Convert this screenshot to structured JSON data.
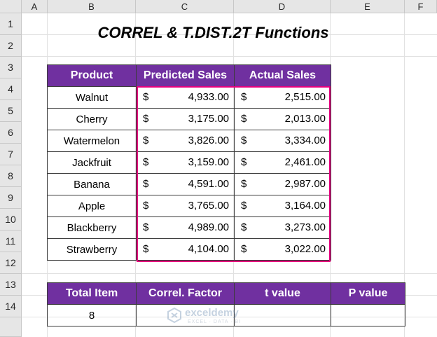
{
  "columns": [
    "A",
    "B",
    "C",
    "D",
    "E",
    "F"
  ],
  "rows": [
    "1",
    "2",
    "3",
    "4",
    "5",
    "6",
    "7",
    "8",
    "9",
    "10",
    "11",
    "12",
    "13",
    "14"
  ],
  "title": "CORREL & T.DIST.2T Functions",
  "main_table": {
    "headers": [
      "Product",
      "Predicted Sales",
      "Actual Sales"
    ],
    "currency": "$",
    "rows": [
      {
        "product": "Walnut",
        "predicted": "4,933.00",
        "actual": "2,515.00"
      },
      {
        "product": "Cherry",
        "predicted": "3,175.00",
        "actual": "2,013.00"
      },
      {
        "product": "Watermelon",
        "predicted": "3,826.00",
        "actual": "3,334.00"
      },
      {
        "product": "Jackfruit",
        "predicted": "3,159.00",
        "actual": "2,461.00"
      },
      {
        "product": "Banana",
        "predicted": "4,591.00",
        "actual": "2,987.00"
      },
      {
        "product": "Apple",
        "predicted": "3,765.00",
        "actual": "3,164.00"
      },
      {
        "product": "Blackberry",
        "predicted": "4,989.00",
        "actual": "3,273.00"
      },
      {
        "product": "Strawberry",
        "predicted": "4,104.00",
        "actual": "3,022.00"
      }
    ]
  },
  "result_table": {
    "headers": [
      "Total Item",
      "Correl. Factor",
      "t value",
      "P value"
    ],
    "values": [
      "8",
      "",
      "",
      ""
    ]
  },
  "watermark": {
    "name": "exceldemy",
    "tagline": "EXCEL · DATA · BI"
  },
  "colors": {
    "header_bg": "#7030a0",
    "header_text": "#ffffff",
    "highlight_border": "#e6007e"
  }
}
